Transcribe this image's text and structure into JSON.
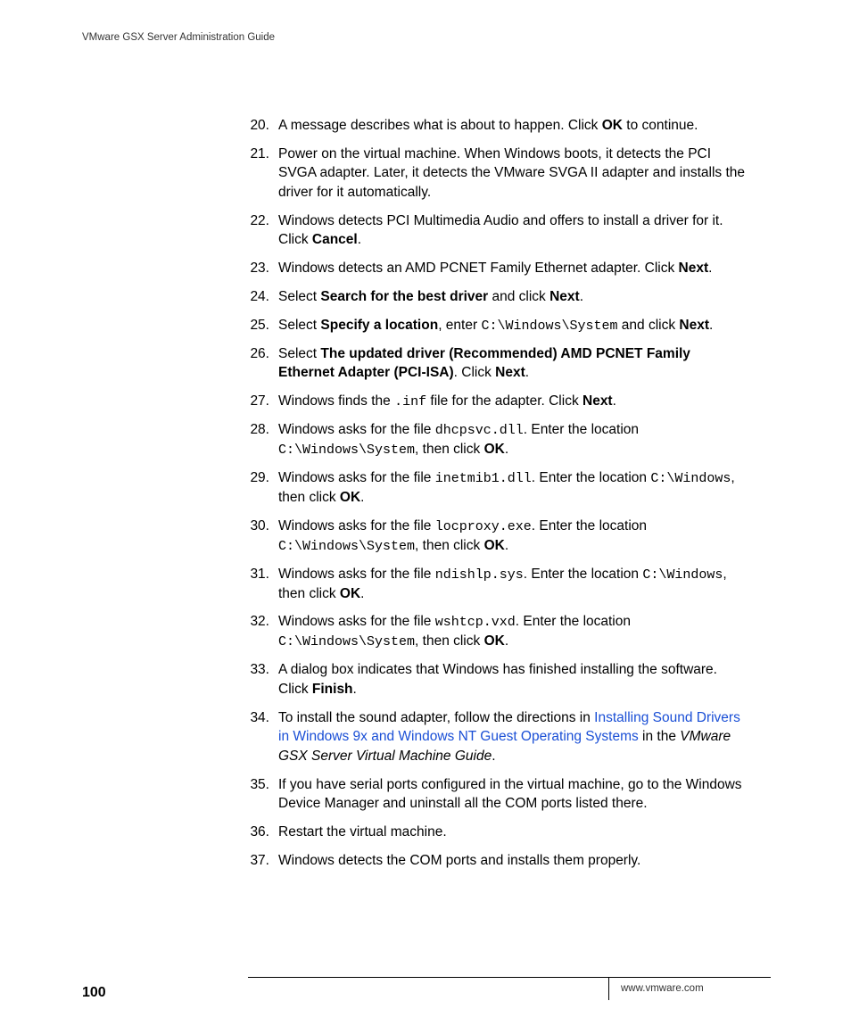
{
  "header": {
    "title": "VMware GSX Server Administration Guide"
  },
  "footer": {
    "page": "100",
    "url": "www.vmware.com"
  },
  "steps": {
    "s20": {
      "num": "20.",
      "t1": "A message describes what is about to happen. Click ",
      "b1": "OK",
      "t2": " to continue."
    },
    "s21": {
      "num": "21.",
      "t1": "Power on the virtual machine. When Windows boots, it detects the PCI SVGA adapter. Later, it detects the VMware SVGA II adapter and installs the driver for it automatically."
    },
    "s22": {
      "num": "22.",
      "t1": "Windows detects PCI Multimedia Audio and offers to install a driver for it. Click ",
      "b1": "Cancel",
      "t2": "."
    },
    "s23": {
      "num": "23.",
      "t1": "Windows detects an AMD PCNET Family Ethernet adapter. Click ",
      "b1": "Next",
      "t2": "."
    },
    "s24": {
      "num": "24.",
      "t1": "Select ",
      "b1": "Search for the best driver",
      "t2": " and click ",
      "b2": "Next",
      "t3": "."
    },
    "s25": {
      "num": "25.",
      "t1": "Select ",
      "b1": "Specify a location",
      "t2": ", enter ",
      "c1": "C:\\Windows\\System",
      "t3": " and click ",
      "b2": "Next",
      "t4": "."
    },
    "s26": {
      "num": "26.",
      "t1": "Select ",
      "b1": "The updated driver (Recommended) AMD PCNET Family Ethernet Adapter (PCI-ISA)",
      "t2": ". Click ",
      "b2": "Next",
      "t3": "."
    },
    "s27": {
      "num": "27.",
      "t1": "Windows finds the ",
      "c1": ".inf",
      "t2": " file for the adapter. Click ",
      "b1": "Next",
      "t3": "."
    },
    "s28": {
      "num": "28.",
      "t1": "Windows asks for the file ",
      "c1": "dhcpsvc.dll",
      "t2": ". Enter the location ",
      "c2": "C:\\Windows\\System",
      "t3": ", then click ",
      "b1": "OK",
      "t4": "."
    },
    "s29": {
      "num": "29.",
      "t1": "Windows asks for the file ",
      "c1": "inetmib1.dll",
      "t2": ". Enter the location ",
      "c2": "C:\\Windows",
      "t3": ", then click ",
      "b1": "OK",
      "t4": "."
    },
    "s30": {
      "num": "30.",
      "t1": "Windows asks for the file ",
      "c1": "locproxy.exe",
      "t2": ". Enter the location ",
      "c2": "C:\\Windows\\System",
      "t3": ", then click ",
      "b1": "OK",
      "t4": "."
    },
    "s31": {
      "num": "31.",
      "t1": "Windows asks for the file ",
      "c1": "ndishlp.sys",
      "t2": ". Enter the location ",
      "c2": "C:\\Windows",
      "t3": ", then click ",
      "b1": "OK",
      "t4": "."
    },
    "s32": {
      "num": "32.",
      "t1": "Windows asks for the file ",
      "c1": "wshtcp.vxd",
      "t2": ". Enter the location ",
      "c2": "C:\\Windows\\System",
      "t3": ", then click ",
      "b1": "OK",
      "t4": "."
    },
    "s33": {
      "num": "33.",
      "t1": "A dialog box indicates that Windows has finished installing the software. Click ",
      "b1": "Finish",
      "t2": "."
    },
    "s34": {
      "num": "34.",
      "t1": "To install the sound adapter, follow the directions in ",
      "l1": "Installing Sound Drivers in Windows 9x and Windows NT Guest Operating Systems",
      "t2": " in the ",
      "i1": "VMware GSX Server Virtual Machine Guide",
      "t3": "."
    },
    "s35": {
      "num": "35.",
      "t1": "If you have serial ports configured in the virtual machine, go to the Windows Device Manager and uninstall all the COM ports listed there."
    },
    "s36": {
      "num": "36.",
      "t1": "Restart the virtual machine."
    },
    "s37": {
      "num": "37.",
      "t1": "Windows detects the COM ports and installs them properly."
    }
  }
}
